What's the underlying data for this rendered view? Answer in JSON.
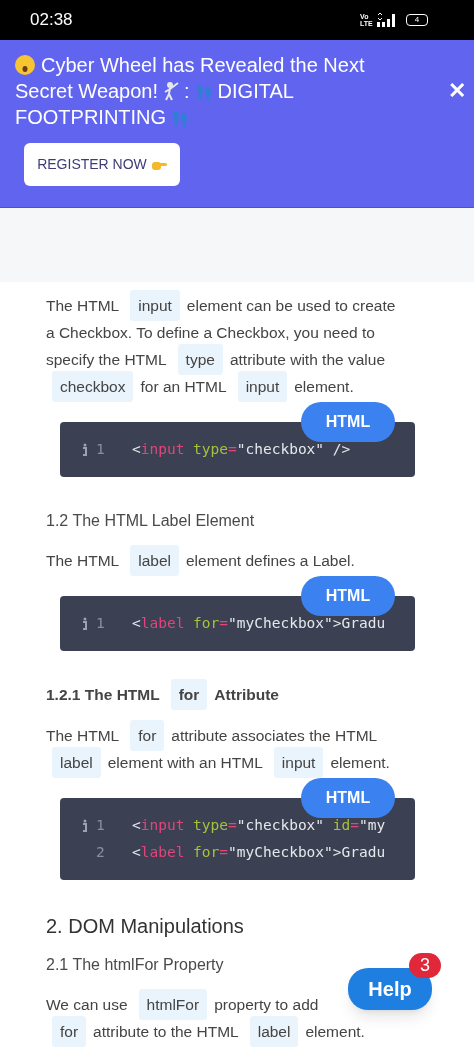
{
  "status_bar": {
    "time": "02:38",
    "network": "Vo LTE",
    "battery": "4"
  },
  "promo_banner": {
    "title_lines": [
      [
        "Cyber Wheel has Revealed the Next"
      ],
      [
        "Secret Weapon!",
        ":",
        "DIGITAL"
      ],
      [
        "FOOTPRINTING"
      ]
    ],
    "button": "REGISTER NOW",
    "close": "✕"
  },
  "content": [
    {
      "kind": "paragraph",
      "lines": [
        [
          {
            "text": "The HTML"
          },
          {
            "code": "input"
          },
          {
            "text": "element can be used to create"
          }
        ],
        [
          {
            "text": "a Checkbox. To define a Checkbox, you need to"
          }
        ],
        [
          {
            "text": "specify the HTML"
          },
          {
            "code": "type"
          },
          {
            "text": "attribute with the value"
          }
        ],
        [
          {
            "code": "checkbox"
          },
          {
            "text": "for an HTML"
          },
          {
            "code": "input"
          },
          {
            "text": "element."
          }
        ]
      ]
    },
    {
      "kind": "code",
      "language": "HTML",
      "lines": [
        {
          "number": "1",
          "info_icon": true,
          "tokens": [
            {
              "kind": "punc",
              "text": "<"
            },
            {
              "kind": "tag",
              "text": "input"
            },
            {
              "kind": "attr",
              "text": " type"
            },
            {
              "kind": "op",
              "text": "="
            },
            {
              "kind": "str",
              "text": "\"checkbox\""
            },
            {
              "kind": "punc",
              "text": " />"
            }
          ]
        }
      ]
    },
    {
      "kind": "subheading",
      "lines": [
        [
          {
            "text": "1.2 The HTML Label Element"
          }
        ]
      ]
    },
    {
      "kind": "paragraph",
      "lines": [
        [
          {
            "text": "The HTML"
          },
          {
            "code": "label"
          },
          {
            "text": "element defines a Label."
          }
        ]
      ]
    },
    {
      "kind": "code",
      "language": "HTML",
      "lines": [
        {
          "number": "1",
          "info_icon": true,
          "tokens": [
            {
              "kind": "punc",
              "text": "<"
            },
            {
              "kind": "tag",
              "text": "label"
            },
            {
              "kind": "attr",
              "text": " for"
            },
            {
              "kind": "op",
              "text": "="
            },
            {
              "kind": "str",
              "text": "\"myCheckbox\""
            },
            {
              "kind": "punc",
              "text": ">Gradu"
            }
          ]
        }
      ]
    },
    {
      "kind": "boldheading",
      "lines": [
        [
          {
            "text": "1.2.1 The HTML"
          },
          {
            "code": "for"
          },
          {
            "text": "Attribute"
          }
        ]
      ]
    },
    {
      "kind": "paragraph",
      "lines": [
        [
          {
            "text": "The HTML"
          },
          {
            "code": "for"
          },
          {
            "text": "attribute associates the HTML"
          }
        ],
        [
          {
            "code": "label"
          },
          {
            "text": "element with an HTML"
          },
          {
            "code": "input"
          },
          {
            "text": "element."
          }
        ]
      ]
    },
    {
      "kind": "code",
      "language": "HTML",
      "lines": [
        {
          "number": "1",
          "info_icon": true,
          "tokens": [
            {
              "kind": "punc",
              "text": "<"
            },
            {
              "kind": "tag",
              "text": "input"
            },
            {
              "kind": "attr",
              "text": " type"
            },
            {
              "kind": "op",
              "text": "="
            },
            {
              "kind": "str",
              "text": "\"checkbox\""
            },
            {
              "kind": "attr",
              "text": " id"
            },
            {
              "kind": "op",
              "text": "="
            },
            {
              "kind": "str",
              "text": "\"my"
            }
          ]
        },
        {
          "number": "2",
          "info_icon": false,
          "tokens": [
            {
              "kind": "punc",
              "text": "<"
            },
            {
              "kind": "tag",
              "text": "label"
            },
            {
              "kind": "attr",
              "text": " for"
            },
            {
              "kind": "op",
              "text": "="
            },
            {
              "kind": "str",
              "text": "\"myCheckbox\""
            },
            {
              "kind": "punc",
              "text": ">Gradu"
            }
          ]
        }
      ]
    },
    {
      "kind": "heading",
      "lines": [
        [
          {
            "text": "2. DOM Manipulations"
          }
        ]
      ]
    },
    {
      "kind": "subheading",
      "lines": [
        [
          {
            "text": "2.1 The htmlFor Property"
          }
        ]
      ]
    },
    {
      "kind": "paragraph",
      "lines": [
        [
          {
            "text": "We can use"
          },
          {
            "code": "htmlFor"
          },
          {
            "text": "property to add"
          }
        ],
        [
          {
            "code": "for"
          },
          {
            "text": "attribute to the HTML"
          },
          {
            "code": "label"
          },
          {
            "text": "element."
          }
        ]
      ]
    }
  ],
  "help_button": {
    "label": "Help",
    "badge": "3"
  }
}
